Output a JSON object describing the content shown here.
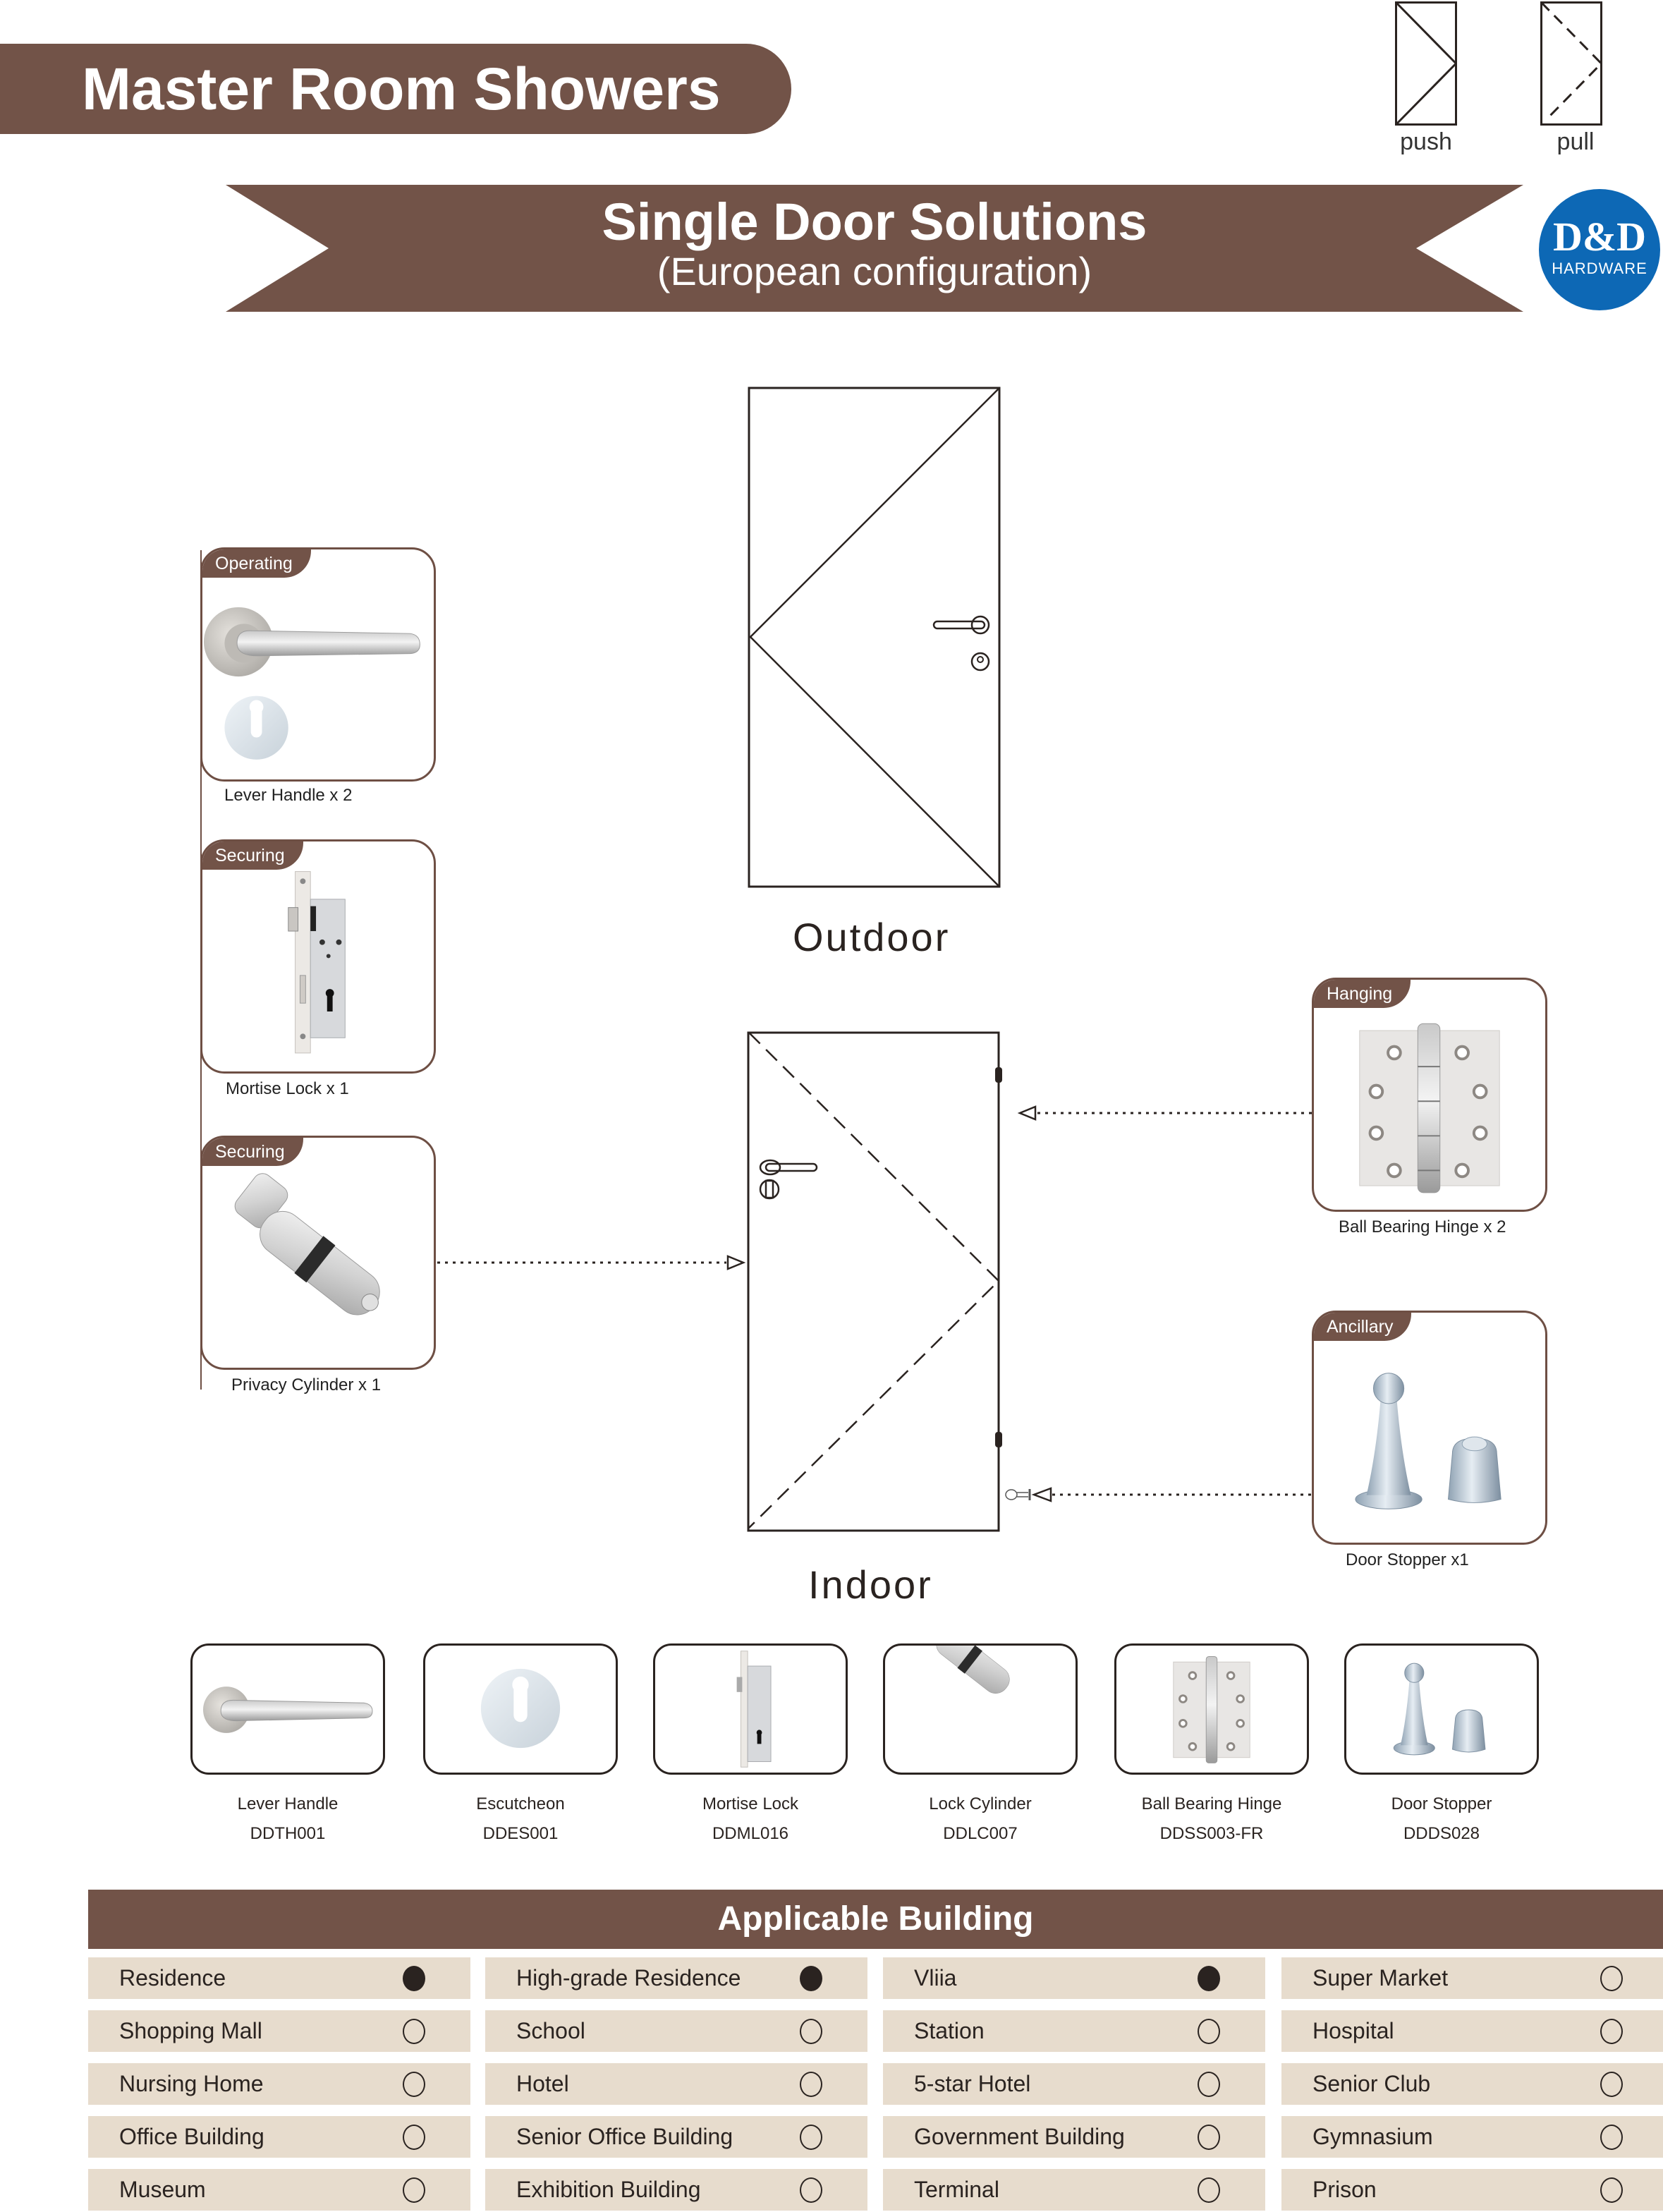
{
  "header": {
    "title": "Master Room Showers"
  },
  "legend": {
    "push_label": "push",
    "pull_label": "pull"
  },
  "banner": {
    "title": "Single Door Solutions",
    "subtitle": "(European configuration)"
  },
  "logo": {
    "mark": "D&D",
    "subtitle": "HARDWARE"
  },
  "colors": {
    "brand_brown": "#725348",
    "table_cell": "#e7dccd",
    "logo_blue": "#0d68b5"
  },
  "doors": {
    "outdoor_label": "Outdoor",
    "indoor_label": "Indoor"
  },
  "components": [
    {
      "category": "Operating",
      "caption": "Lever Handle x 2",
      "icon": "lever-handle-escutcheon"
    },
    {
      "category": "Securing",
      "caption": "Mortise Lock x 1",
      "icon": "mortise-lock"
    },
    {
      "category": "Securing",
      "caption": "Privacy Cylinder x 1",
      "icon": "privacy-cylinder"
    },
    {
      "category": "Hanging",
      "caption": "Ball Bearing Hinge x 2",
      "icon": "ball-bearing-hinge"
    },
    {
      "category": "Ancillary",
      "caption": "Door Stopper x1",
      "icon": "door-stopper"
    }
  ],
  "products": [
    {
      "name": "Lever Handle",
      "code": "DDTH001"
    },
    {
      "name": "Escutcheon",
      "code": "DDES001"
    },
    {
      "name": "Mortise Lock",
      "code": "DDML016"
    },
    {
      "name": "Lock Cylinder",
      "code": "DDLC007"
    },
    {
      "name": "Ball Bearing Hinge",
      "code": "DDSS003-FR"
    },
    {
      "name": "Door Stopper",
      "code": "DDDS028"
    }
  ],
  "applicable_building": {
    "title": "Applicable Building",
    "columns": [
      [
        {
          "label": "Residence",
          "checked": true
        },
        {
          "label": "Shopping Mall",
          "checked": false
        },
        {
          "label": "Nursing Home",
          "checked": false
        },
        {
          "label": "Office Building",
          "checked": false
        },
        {
          "label": "Museum",
          "checked": false
        }
      ],
      [
        {
          "label": "High-grade Residence",
          "checked": true
        },
        {
          "label": "School",
          "checked": false
        },
        {
          "label": "Hotel",
          "checked": false
        },
        {
          "label": "Senior Office Building",
          "checked": false
        },
        {
          "label": "Exhibition Building",
          "checked": false
        }
      ],
      [
        {
          "label": "Vliia",
          "checked": true
        },
        {
          "label": "Station",
          "checked": false
        },
        {
          "label": "5-star Hotel",
          "checked": false
        },
        {
          "label": "Government Building",
          "checked": false
        },
        {
          "label": "Terminal",
          "checked": false
        }
      ],
      [
        {
          "label": "Super Market",
          "checked": false
        },
        {
          "label": "Hospital",
          "checked": false
        },
        {
          "label": "Senior Club",
          "checked": false
        },
        {
          "label": "Gymnasium",
          "checked": false
        },
        {
          "label": "Prison",
          "checked": false
        }
      ]
    ]
  }
}
